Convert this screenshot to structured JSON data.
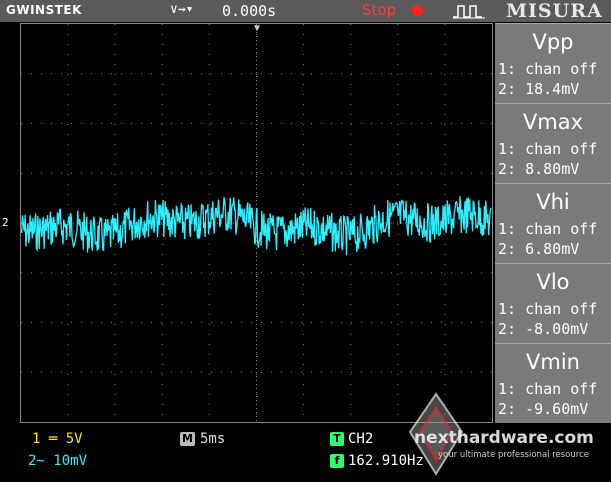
{
  "header": {
    "brand": "GWINSTEK",
    "trigger_symbol": "∨⇝▾",
    "time_offset": "0.000s",
    "run_state": "Stop",
    "headline": "MISURA"
  },
  "waveform": {
    "channel_marker": "2",
    "trace_color": "#2cf0ff",
    "level_fraction": 0.505,
    "noise_peak_fraction": 0.055
  },
  "measurements": [
    {
      "title": "Vpp",
      "line1": "1: chan off",
      "line2": "2: 18.4mV"
    },
    {
      "title": "Vmax",
      "line1": "1: chan off",
      "line2": "2: 8.80mV"
    },
    {
      "title": "Vhi",
      "line1": "1: chan off",
      "line2": "2: 6.80mV"
    },
    {
      "title": "Vlo",
      "line1": "1: chan off",
      "line2": "2: -8.00mV"
    },
    {
      "title": "Vmin",
      "line1": "1: chan off",
      "line2": "2: -9.60mV"
    }
  ],
  "status": {
    "ch1": "1 ═ 5V",
    "ch2": "2∼ 10mV",
    "timebase_icon": "M",
    "timebase": "5ms",
    "trigger_icon": "T",
    "trigger_source": "CH2",
    "frequency_icon": "f",
    "frequency": "162.910Hz"
  },
  "watermark": {
    "site": "nexthardware.com",
    "tagline": "your ultimate professional resource"
  },
  "colors": {
    "ch1": "#ffe000",
    "ch2": "#2cf0ff",
    "stop": "#ff3b3b",
    "panel": "#7a7a7a"
  }
}
